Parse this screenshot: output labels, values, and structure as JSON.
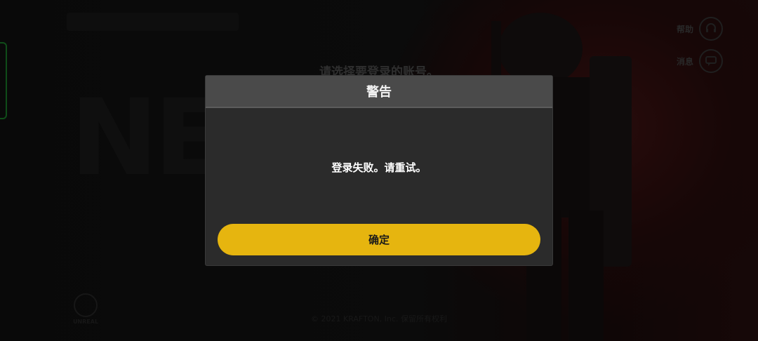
{
  "background": {
    "prompt": "请选择要登录的账号。",
    "help_label": "帮助",
    "announcement_label": "消息",
    "logo_text": "NEW",
    "engine_logo_text": "UNREAL",
    "copyright": "© 2021 KRAFTON, Inc. 保留所有权利"
  },
  "dialog": {
    "title": "警告",
    "message": "登录失败。请重试。",
    "confirm_label": "确定"
  },
  "colors": {
    "confirm_button": "#e6b50f",
    "dialog_bg": "#2b2b2b",
    "dialog_header": "#4a4a4a",
    "left_tab_border": "#1c8a2e"
  },
  "icons": {
    "help": "headset-icon",
    "announcement": "chat-icon"
  }
}
